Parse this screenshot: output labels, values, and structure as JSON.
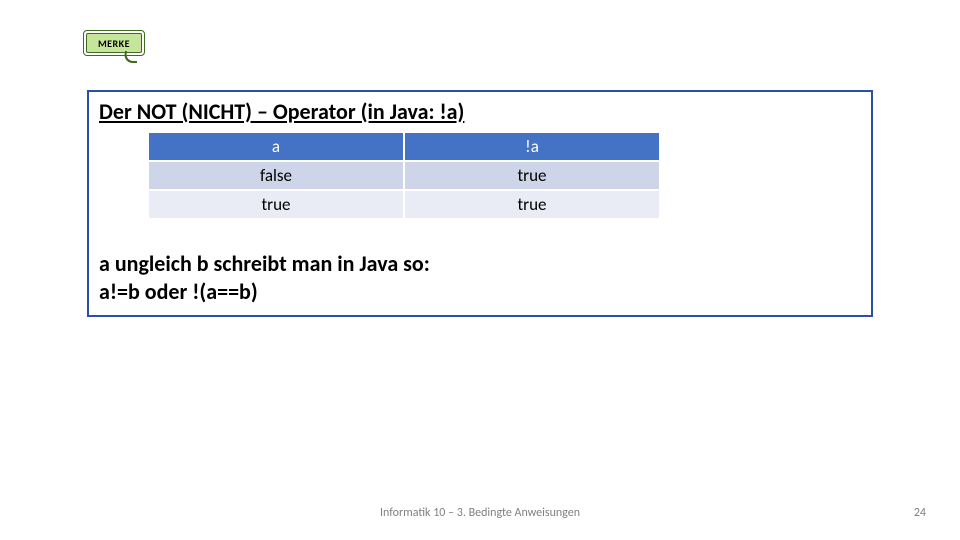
{
  "badge": {
    "label": "MERKE"
  },
  "heading": "Der NOT (NICHT) – Operator (in Java:  !a)",
  "table": {
    "headers": [
      "a",
      "!a"
    ],
    "rows": [
      [
        "false",
        "true"
      ],
      [
        "true",
        "true"
      ]
    ]
  },
  "note_line1": "a ungleich b schreibt man in Java so:",
  "note_line2": "a!=b oder !(a==b)",
  "footer": "Informatik 10 – 3. Bedingte Anweisungen",
  "page": "24"
}
